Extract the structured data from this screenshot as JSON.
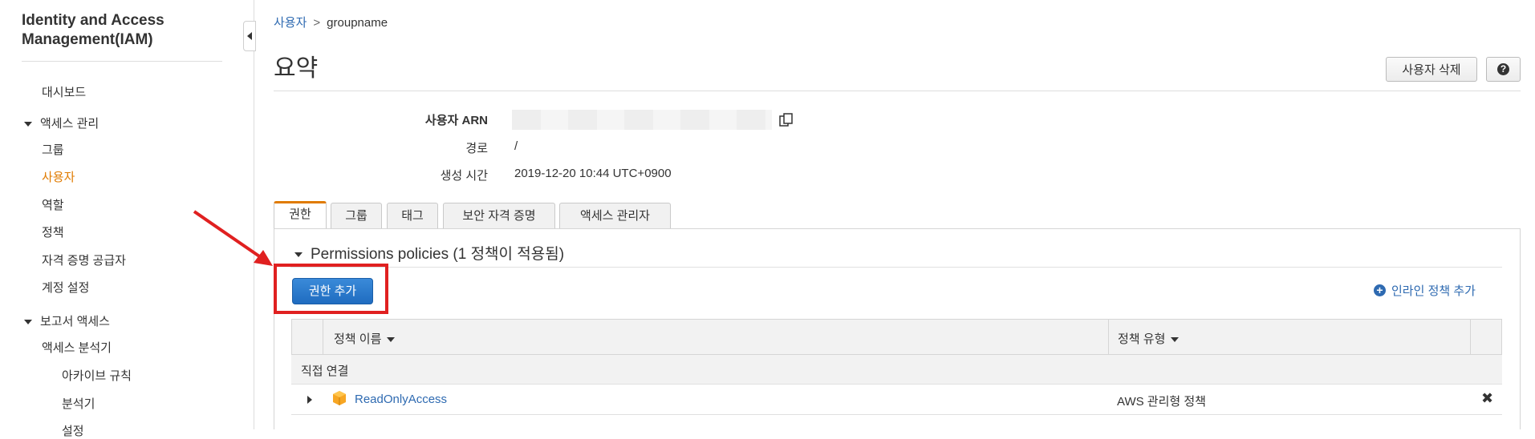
{
  "sidebar": {
    "title": "Identity and Access Management(IAM)",
    "dashboard": "대시보드",
    "access_mgmt": {
      "label": "액세스 관리",
      "items": [
        "그룹",
        "사용자",
        "역할",
        "정책",
        "자격 증명 공급자",
        "계정 설정"
      ]
    },
    "reports": {
      "label": "보고서 액세스",
      "items": [
        "액세스 분석기",
        "아카이브 규칙",
        "분석기",
        "설정"
      ]
    }
  },
  "breadcrumb": {
    "parent": "사용자",
    "current": "groupname"
  },
  "page": {
    "title": "요약",
    "delete_button": "사용자 삭제",
    "help_button": "?"
  },
  "summary": {
    "arn_label": "사용자 ARN",
    "path_label": "경로",
    "path_value": "/",
    "created_label": "생성 시간",
    "created_value": "2019-12-20 10:44 UTC+0900"
  },
  "tabs": [
    "권한",
    "그룹",
    "태그",
    "보안 자격 증명",
    "액세스 관리자"
  ],
  "permissions": {
    "header": "Permissions policies (1 정책이 적용됨)",
    "add_button": "권한 추가",
    "inline_link": "인라인 정책 추가",
    "columns": {
      "name": "정책 이름",
      "type": "정책 유형"
    },
    "group_label": "직접 연결",
    "rows": [
      {
        "name": "ReadOnlyAccess",
        "type": "AWS 관리형 정책"
      }
    ]
  },
  "colors": {
    "accent": "#e07b00",
    "link": "#2e6ab1",
    "primary": "#1f6cc0",
    "highlight": "#e02020"
  }
}
